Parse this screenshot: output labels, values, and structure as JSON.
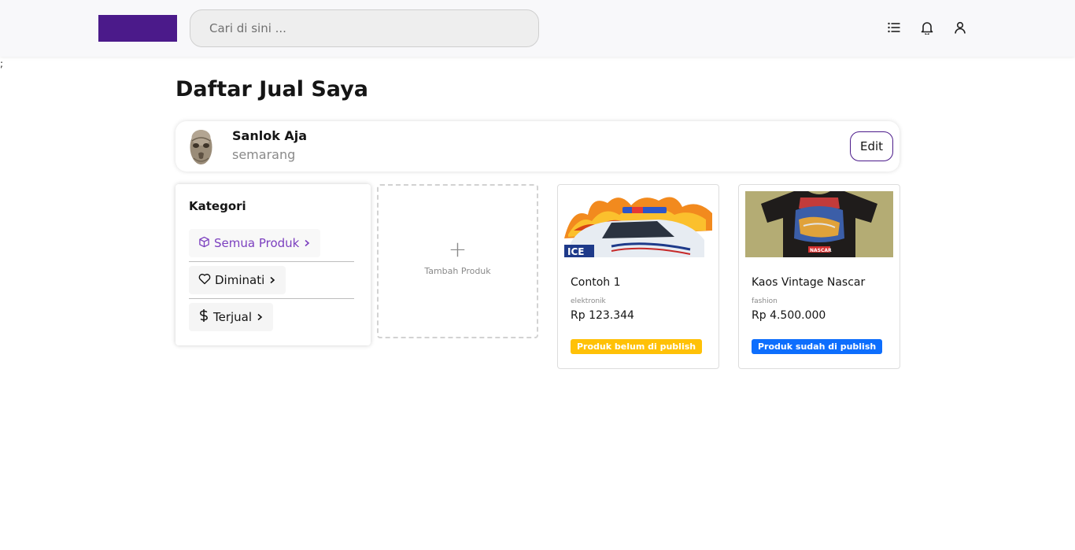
{
  "header": {
    "search_placeholder": "Cari di sini ...",
    "icons": [
      "list-icon",
      "bell-icon",
      "user-icon"
    ],
    "logo_color": "#4b1a8a"
  },
  "stray_text": ";",
  "page": {
    "title": "Daftar Jual Saya"
  },
  "profile": {
    "name": "Sanlok Aja",
    "city": "semarang",
    "edit_label": "Edit"
  },
  "kategori": {
    "title": "Kategori",
    "items": [
      {
        "icon": "box-icon",
        "label": "Semua Produk",
        "active": true
      },
      {
        "icon": "heart-icon",
        "label": "Diminati",
        "active": false
      },
      {
        "icon": "dollar-icon",
        "label": "Terjual",
        "active": false
      }
    ]
  },
  "add_product": {
    "plus": "+",
    "label": "Tambah Produk"
  },
  "products": [
    {
      "name": "Contoh 1",
      "category": "elektronik",
      "price": "Rp 123.344",
      "status": "Produk belum di publish",
      "status_color": "#ffc107",
      "image": "burning-police-car-photo"
    },
    {
      "name": "Kaos Vintage Nascar",
      "category": "fashion",
      "price": "Rp 4.500.000",
      "status": "Produk sudah di publish",
      "status_color": "#0d6efd",
      "image": "vintage-nascar-tshirt-photo"
    }
  ],
  "colors": {
    "accent": "#4b1a8a",
    "active_category": "#7b3fbf"
  }
}
